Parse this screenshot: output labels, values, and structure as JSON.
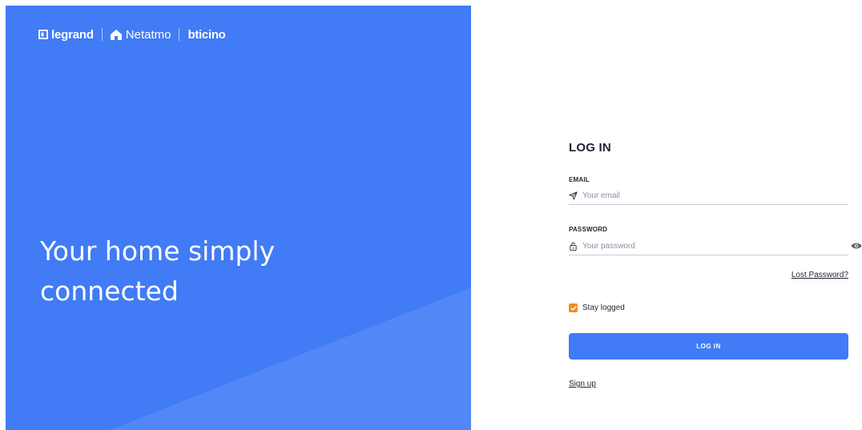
{
  "brand": {
    "legrand": "legrand",
    "netatmo": "Netatmo",
    "bticino": "bticino",
    "accent_color": "#417bf5"
  },
  "hero": {
    "tagline_line1": "Your home simply",
    "tagline_line2": "connected"
  },
  "login": {
    "title": "LOG IN",
    "email_label": "EMAIL",
    "email_placeholder": "Your email",
    "email_icon": "send-icon",
    "password_label": "PASSWORD",
    "password_placeholder": "Your password",
    "password_icon": "lock-icon",
    "show_password_icon": "eye-icon",
    "lost_password": "Lost Password?",
    "stay_logged_label": "Stay logged",
    "stay_logged_checked": true,
    "checkbox_color": "#f28c28",
    "submit_label": "LOG IN",
    "signup_link": "Sign up"
  }
}
